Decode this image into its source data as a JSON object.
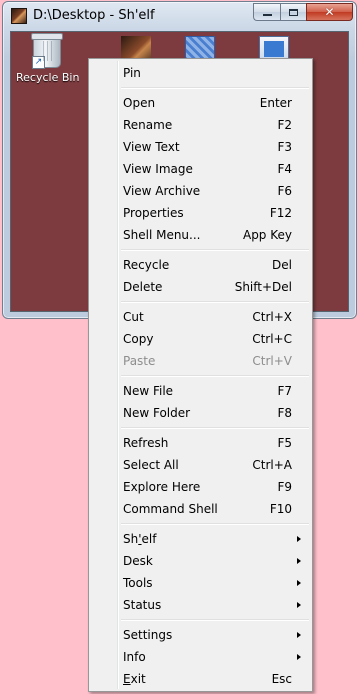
{
  "window": {
    "title": "D:\\Desktop - Sh'elf",
    "controls": {
      "minimize_icon": "minimize-icon",
      "maximize_icon": "maximize-icon",
      "close_icon": "close-icon"
    }
  },
  "desktop": {
    "background_color": "#7d3b3f",
    "icons": [
      {
        "label": "Recycle Bin",
        "icon": "recycle-bin-icon"
      },
      {
        "label": "",
        "icon": "image-file-icon"
      },
      {
        "label": "",
        "icon": "pattern-file-icon"
      },
      {
        "label": "",
        "icon": "shortcut-icon"
      }
    ]
  },
  "context_menu": {
    "items": [
      {
        "label": "Pin",
        "shortcut": ""
      },
      {
        "label": "Open",
        "shortcut": "Enter"
      },
      {
        "label": "Rename",
        "shortcut": "F2"
      },
      {
        "label": "View Text",
        "shortcut": "F3"
      },
      {
        "label": "View Image",
        "shortcut": "F4"
      },
      {
        "label": "View Archive",
        "shortcut": "F6"
      },
      {
        "label": "Properties",
        "shortcut": "F12"
      },
      {
        "label": "Shell Menu...",
        "shortcut": "App Key"
      },
      {
        "label": "Recycle",
        "shortcut": "Del"
      },
      {
        "label": "Delete",
        "shortcut": "Shift+Del"
      },
      {
        "label": "Cut",
        "shortcut": "Ctrl+X"
      },
      {
        "label": "Copy",
        "shortcut": "Ctrl+C"
      },
      {
        "label": "Paste",
        "shortcut": "Ctrl+V"
      },
      {
        "label": "New File",
        "shortcut": "F7"
      },
      {
        "label": "New Folder",
        "shortcut": "F8"
      },
      {
        "label": "Refresh",
        "shortcut": "F5"
      },
      {
        "label": "Select All",
        "shortcut": "Ctrl+A"
      },
      {
        "label": "Explore Here",
        "shortcut": "F9"
      },
      {
        "label": "Command Shell",
        "shortcut": "F10"
      },
      {
        "label_pre": "Sh",
        "label_ul": "'",
        "label_post": "elf",
        "shortcut": ""
      },
      {
        "label": "Desk",
        "shortcut": ""
      },
      {
        "label": "Tools",
        "shortcut": ""
      },
      {
        "label": "Status",
        "shortcut": ""
      },
      {
        "label": "Settings",
        "shortcut": ""
      },
      {
        "label": "Info",
        "shortcut": ""
      },
      {
        "label_ul": "E",
        "label_post": "xit",
        "shortcut": "Esc"
      }
    ]
  }
}
